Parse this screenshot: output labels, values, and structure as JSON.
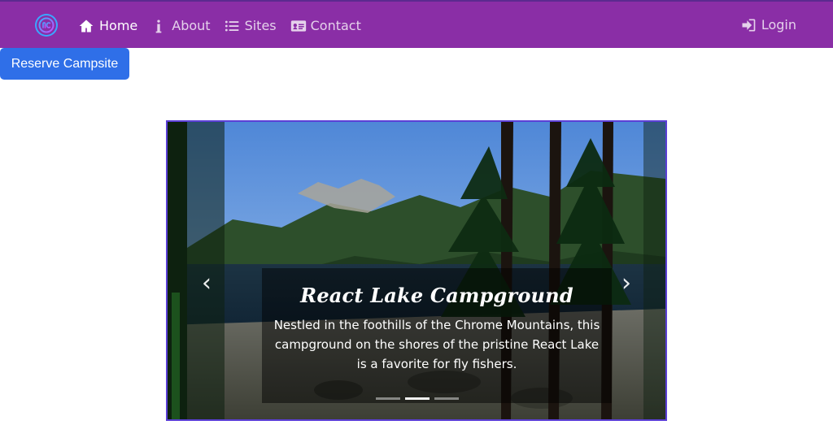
{
  "nav": {
    "brand_icon": "brand-logo-icon",
    "items": [
      {
        "label": "Home",
        "icon": "home-icon",
        "active": true
      },
      {
        "label": "About",
        "icon": "info-icon",
        "active": false
      },
      {
        "label": "Sites",
        "icon": "list-icon",
        "active": false
      },
      {
        "label": "Contact",
        "icon": "address-card-icon",
        "active": false
      }
    ],
    "login": {
      "label": "Login",
      "icon": "login-icon"
    }
  },
  "reserve_button": {
    "label": "Reserve Campsite"
  },
  "carousel": {
    "slide": {
      "title": "React Lake Campground",
      "text": "Nestled in the foothills of the Chrome Mountains, this campground on the shores of the pristine React Lake is a favorite for fly fishers."
    },
    "indicators": {
      "count": 3,
      "active_index": 1
    },
    "controls": {
      "prev_glyph": "‹",
      "next_glyph": "›"
    }
  },
  "colors": {
    "navbar": "#8a2ea6",
    "button": "#2f6fe8",
    "carousel_border": "#5b3fd6"
  }
}
